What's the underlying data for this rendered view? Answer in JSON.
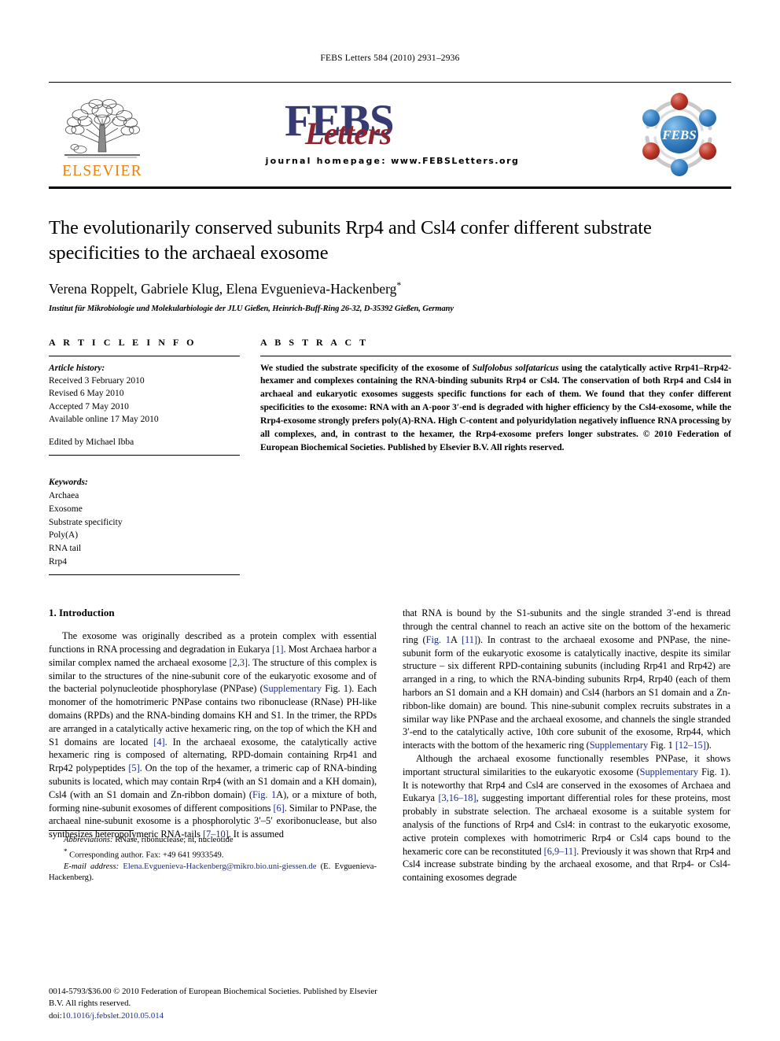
{
  "running_head": "FEBS Letters 584 (2010) 2931–2936",
  "masthead": {
    "publisher_name": "ELSEVIER",
    "journal_name_main": "FEBS",
    "journal_name_script": "Letters",
    "homepage_label": "journal homepage:",
    "homepage_url": "www.FEBSLetters.org",
    "society_logo_text": "FEBS",
    "colors": {
      "elsevier_orange": "#E8820C",
      "febs_navy": "#363B72",
      "letters_red": "#8E2430",
      "logo_blue": "#2E7CC4",
      "logo_red": "#C0392B",
      "link_blue": "#1B2C8A"
    }
  },
  "article": {
    "title": "The evolutionarily conserved subunits Rrp4 and Csl4 confer different substrate specificities to the archaeal exosome",
    "authors": "Verena Roppelt, Gabriele Klug, Elena Evguenieva-Hackenberg",
    "corresponding_marker": "*",
    "affiliation": "Institut für Mikrobiologie und Molekularbiologie der JLU Gießen, Heinrich-Buff-Ring 26-32, D-35392 Gießen, Germany"
  },
  "article_info": {
    "heading": "A R T I C L E   I N F O",
    "history_label": "Article history:",
    "history": [
      "Received 3 February 2010",
      "Revised 6 May 2010",
      "Accepted 7 May 2010",
      "Available online 17 May 2010"
    ],
    "editor": "Edited by Michael Ibba",
    "keywords_label": "Keywords:",
    "keywords": [
      "Archaea",
      "Exosome",
      "Substrate specificity",
      "Poly(A)",
      "RNA tail",
      "Rrp4"
    ]
  },
  "abstract": {
    "heading": "A B S T R A C T",
    "text_part1": "We studied the substrate specificity of the exosome of ",
    "organism": "Sulfolobus solfataricus",
    "text_part2": " using the catalytically active Rrp41–Rrp42-hexamer and complexes containing the RNA-binding subunits Rrp4 or Csl4. The conservation of both Rrp4 and Csl4 in archaeal and eukaryotic exosomes suggests specific functions for each of them. We found that they confer different specificities to the exosome: RNA with an A-poor 3′-end is degraded with higher efficiency by the Csl4-exosome, while the Rrp4-exosome strongly prefers poly(A)-RNA. High C-content and polyuridylation negatively influence RNA processing by all complexes, and, in contrast to the hexamer, the Rrp4-exosome prefers longer substrates.",
    "copyright": "© 2010 Federation of European Biochemical Societies. Published by Elsevier B.V. All rights reserved."
  },
  "introduction": {
    "heading": "1. Introduction",
    "left_paragraph": {
      "s1": "The exosome was originally described as a protein complex with essential functions in RNA processing and degradation in Eukarya ",
      "r1": "[1]",
      "s2": ". Most Archaea harbor a similar complex named the archaeal exosome ",
      "r2": "[2,3]",
      "s3": ". The structure of this complex is similar to the structures of the nine-subunit core of the eukaryotic exosome and of the bacterial polynucleotide phosphorylase (PNPase) (",
      "r3": "Supplementary",
      "s4": " Fig. 1). Each monomer of the homotrimeric PNPase contains two ribonuclease (RNase) PH-like domains (RPDs) and the RNA-binding domains KH and S1. In the trimer, the RPDs are arranged in a catalytically active hexameric ring, on the top of which the KH and S1 domains are located ",
      "r4": "[4]",
      "s5": ". In the archaeal exosome, the catalytically active hexameric ring is composed of alternating, RPD-domain containing Rrp41 and Rrp42 polypeptides ",
      "r5": "[5]",
      "s6": ". On the top of the hexamer, a trimeric cap of RNA-binding subunits is located, which may contain Rrp4 (with an S1 domain and a KH domain), Csl4 (with an S1 domain and Zn-ribbon domain) (",
      "r6": "Fig. 1",
      "s7": "A), or a mixture of both, forming nine-subunit exosomes of different compositions ",
      "r7": "[6]",
      "s8": ". Similar to PNPase, the archaeal nine-subunit exosome is a phosphorolytic 3′–5′ exoribonuclease, but also synthesizes heteropolymeric RNA-tails ",
      "r8": "[7–10]",
      "s9": ". It is assumed"
    },
    "right_paragraph_1": {
      "s1": "that RNA is bound by the S1-subunits and the single stranded 3′-end is thread through the central channel to reach an active site on the bottom of the hexameric ring (",
      "r1": "Fig. 1",
      "s2": "A ",
      "r2": "[11]",
      "s3": "). In contrast to the archaeal exosome and PNPase, the nine-subunit form of the eukaryotic exosome is catalytically inactive, despite its similar structure – six different RPD-containing subunits (including Rrp41 and Rrp42) are arranged in a ring, to which the RNA-binding subunits Rrp4, Rrp40 (each of them harbors an S1 domain and a KH domain) and Csl4 (harbors an S1 domain and a Zn-ribbon-like domain) are bound. This nine-subunit complex recruits substrates in a similar way like PNPase and the archaeal exosome, and channels the single stranded 3′-end to the catalytically active, 10th core subunit of the exosome, Rrp44, which interacts with the bottom of the hexameric ring (",
      "r3": "Supplementary",
      "s4": " Fig. 1 ",
      "r4": "[12–15]",
      "s5": ")."
    },
    "right_paragraph_2": {
      "s1": "Although the archaeal exosome functionally resembles PNPase, it shows important structural similarities to the eukaryotic exosome (",
      "r1": "Supplementary",
      "s2": " Fig. 1). It is noteworthy that Rrp4 and Csl4 are conserved in the exosomes of Archaea and Eukarya ",
      "r2": "[3,16–18]",
      "s3": ", suggesting important differential roles for these proteins, most probably in substrate selection. The archaeal exosome is a suitable system for analysis of the functions of Rrp4 and Csl4: in contrast to the eukaryotic exosome, active protein complexes with homotrimeric Rrp4 or Csl4 caps bound to the hexameric core can be reconstituted ",
      "r3": "[6,9–11]",
      "s4": ". Previously it was shown that Rrp4 and Csl4 increase substrate binding by the archaeal exosome, and that Rrp4- or Csl4-containing exosomes degrade"
    }
  },
  "footnotes": {
    "abbreviations_label": "Abbreviations:",
    "abbreviations_text": " RNase, ribonuclease; nt, nucleotide",
    "corresponding_marker": "*",
    "corresponding_text": " Corresponding author. Fax: +49 641 9933549.",
    "email_label": "E-mail address:",
    "email": "Elena.Evguenieva-Hackenberg@mikro.bio.uni-giessen.de",
    "email_suffix": " (E. Evguenieva-Hackenberg)."
  },
  "footer": {
    "issn_line": "0014-5793/$36.00 © 2010 Federation of European Biochemical Societies. Published by Elsevier B.V. All rights reserved.",
    "doi_label": "doi:",
    "doi_value": "10.1016/j.febslet.2010.05.014"
  }
}
